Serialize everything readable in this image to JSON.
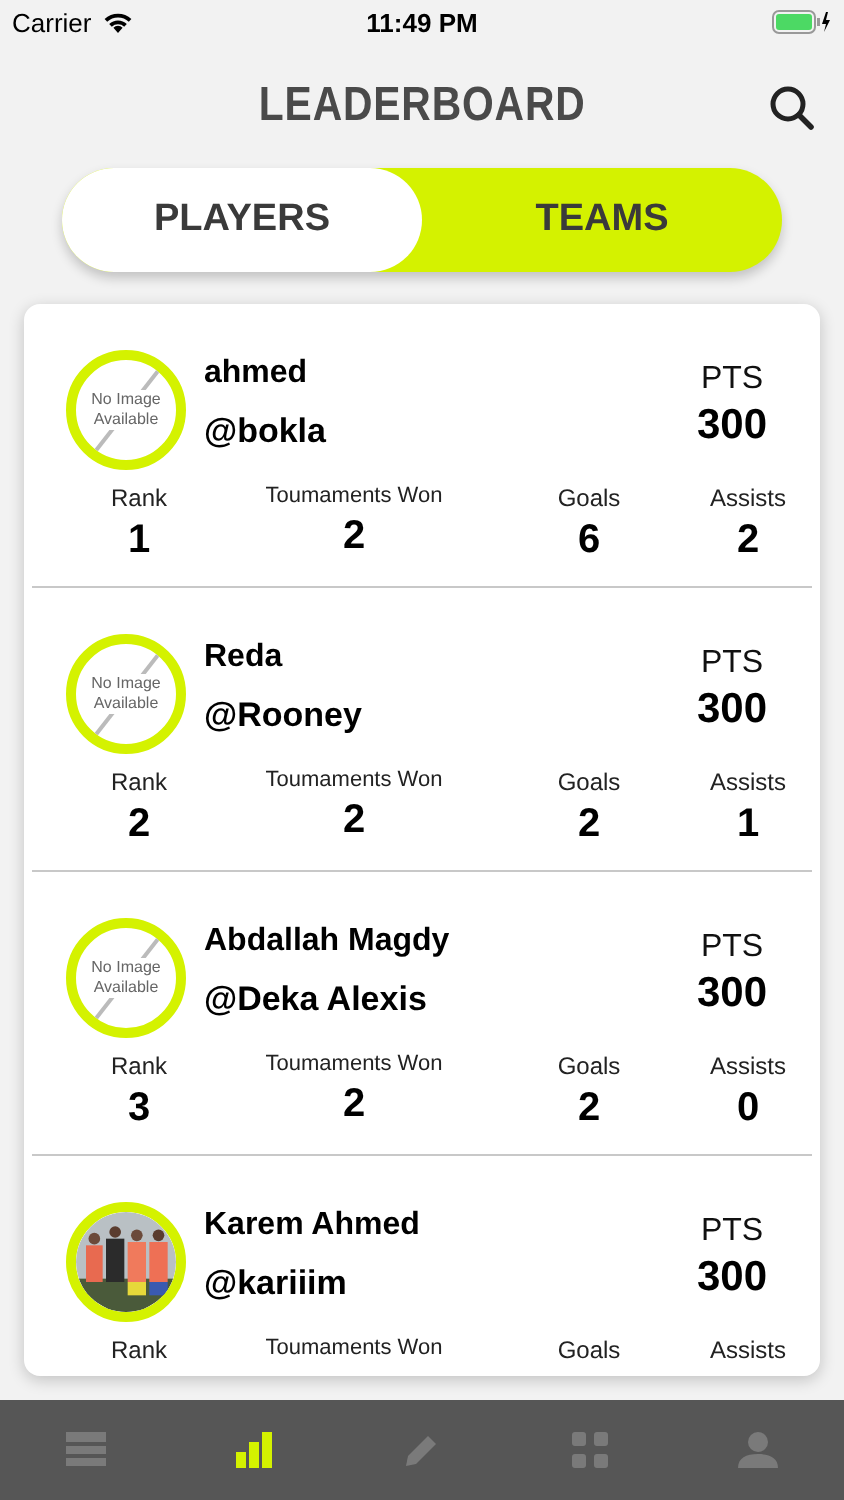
{
  "status_bar": {
    "carrier": "Carrier",
    "time": "11:49 PM"
  },
  "header": {
    "title": "LEADERBOARD"
  },
  "segments": [
    {
      "label": "PLAYERS",
      "selected": false
    },
    {
      "label": "TEAMS",
      "selected": true
    }
  ],
  "players": [
    {
      "name": "ahmed",
      "handle": "@bokla",
      "avatar": {
        "kind": "placeholder",
        "text": "No Image Available"
      },
      "points_label": "PTS",
      "points": "300",
      "stats": [
        {
          "label": "Rank",
          "value": "1"
        },
        {
          "label": "Toumaments Won",
          "value": "2"
        },
        {
          "label": "Goals",
          "value": "6"
        },
        {
          "label": "Assists",
          "value": "2"
        }
      ]
    },
    {
      "name": "Reda",
      "handle": "@Rooney",
      "avatar": {
        "kind": "placeholder",
        "text": "No Image Available"
      },
      "points_label": "PTS",
      "points": "300",
      "stats": [
        {
          "label": "Rank",
          "value": "2"
        },
        {
          "label": "Toumaments Won",
          "value": "2"
        },
        {
          "label": "Goals",
          "value": "2"
        },
        {
          "label": "Assists",
          "value": "1"
        }
      ]
    },
    {
      "name": "Abdallah Magdy",
      "handle": "@Deka Alexis",
      "avatar": {
        "kind": "placeholder",
        "text": "No Image Available"
      },
      "points_label": "PTS",
      "points": "300",
      "stats": [
        {
          "label": "Rank",
          "value": "3"
        },
        {
          "label": "Toumaments Won",
          "value": "2"
        },
        {
          "label": "Goals",
          "value": "2"
        },
        {
          "label": "Assists",
          "value": "0"
        }
      ]
    },
    {
      "name": "Karem Ahmed",
      "handle": "@kariiim",
      "avatar": {
        "kind": "picture"
      },
      "points_label": "PTS",
      "points": "300",
      "stats": [
        {
          "label": "Rank"
        },
        {
          "label": "Toumaments Won"
        },
        {
          "label": "Goals"
        },
        {
          "label": "Assists"
        }
      ]
    }
  ],
  "tab_bar": [
    {
      "kind": "list",
      "selected": false
    },
    {
      "kind": "chart",
      "selected": true
    },
    {
      "kind": "pencil",
      "selected": false
    },
    {
      "kind": "grid",
      "selected": false
    },
    {
      "kind": "person",
      "selected": false
    }
  ]
}
